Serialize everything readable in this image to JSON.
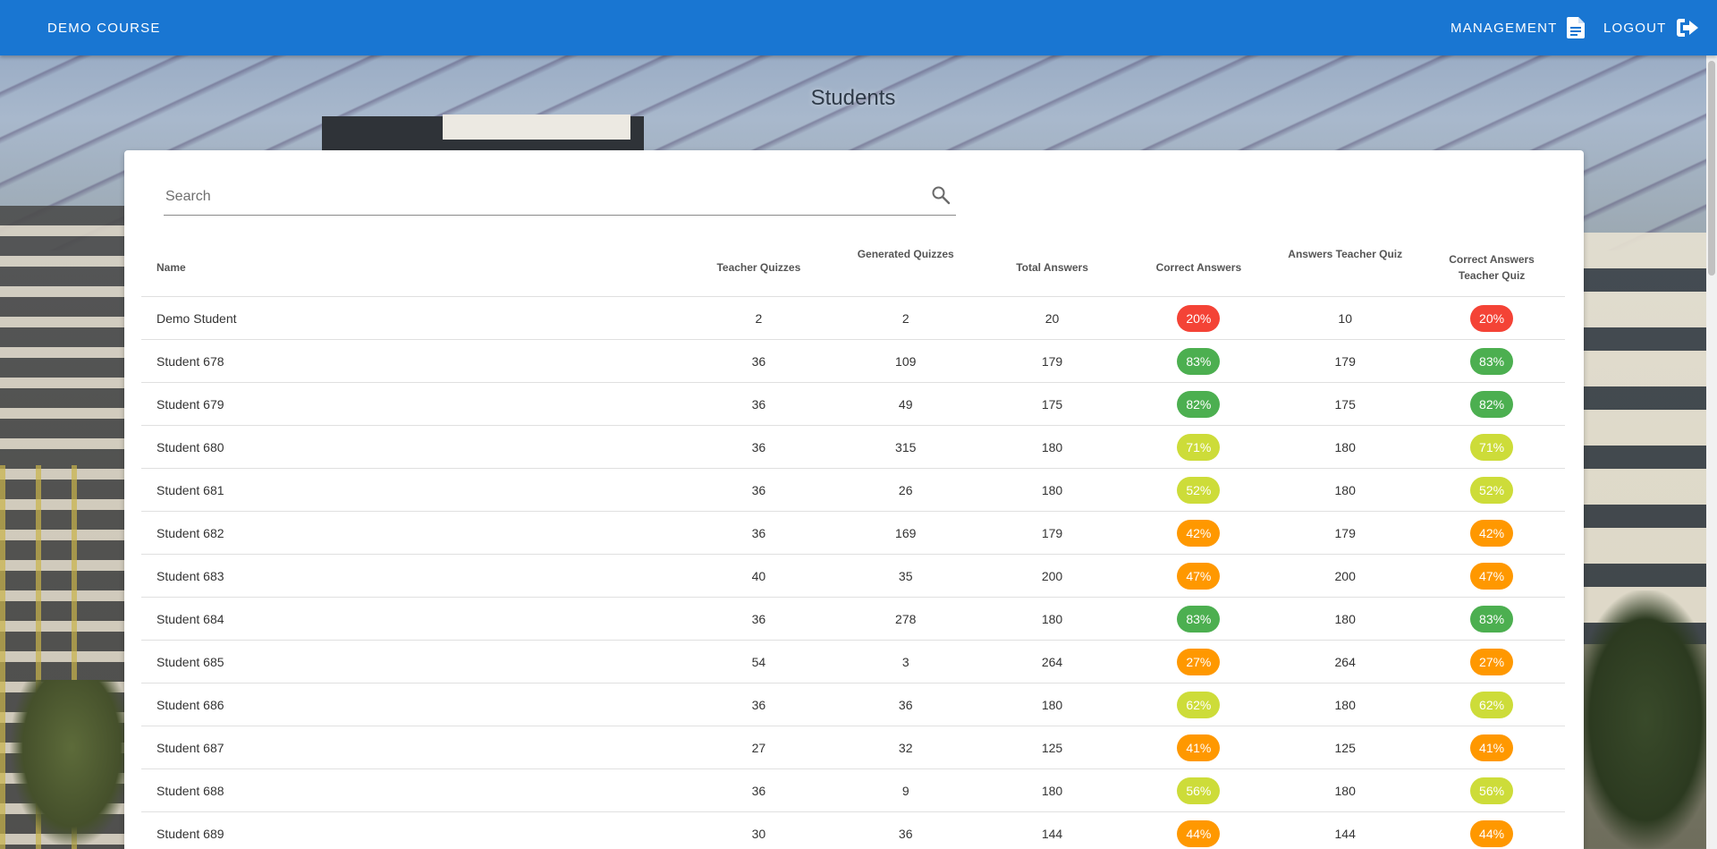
{
  "app_bar": {
    "brand": "DEMO COURSE",
    "management_label": "MANAGEMENT",
    "management_icon": "document-icon",
    "logout_label": "LOGOUT",
    "logout_icon": "logout-icon",
    "color": "#1976d2"
  },
  "page_title": "Students",
  "search": {
    "placeholder": "Search",
    "value": "",
    "icon": "search-icon"
  },
  "table": {
    "columns": {
      "name": "Name",
      "teacher_quizzes": "Teacher Quizzes",
      "generated_quizzes": "Generated Quizzes",
      "total_answers": "Total Answers",
      "correct_answers": "Correct Answers",
      "answers_teacher_quiz": "Answers Teacher Quiz",
      "correct_answers_teacher_quiz_line1": "Correct Answers",
      "correct_answers_teacher_quiz_line2": "Teacher Quiz"
    },
    "rows": [
      {
        "name": "Demo Student",
        "teacher_quizzes": "2",
        "generated_quizzes": "2",
        "total_answers": "20",
        "correct_answers": "20%",
        "answers_teacher_quiz": "10",
        "correct_answers_teacher_quiz": "20%",
        "chip_color": "#f44336"
      },
      {
        "name": "Student 678",
        "teacher_quizzes": "36",
        "generated_quizzes": "109",
        "total_answers": "179",
        "correct_answers": "83%",
        "answers_teacher_quiz": "179",
        "correct_answers_teacher_quiz": "83%",
        "chip_color": "#4caf50"
      },
      {
        "name": "Student 679",
        "teacher_quizzes": "36",
        "generated_quizzes": "49",
        "total_answers": "175",
        "correct_answers": "82%",
        "answers_teacher_quiz": "175",
        "correct_answers_teacher_quiz": "82%",
        "chip_color": "#4caf50"
      },
      {
        "name": "Student 680",
        "teacher_quizzes": "36",
        "generated_quizzes": "315",
        "total_answers": "180",
        "correct_answers": "71%",
        "answers_teacher_quiz": "180",
        "correct_answers_teacher_quiz": "71%",
        "chip_color": "#cddc39"
      },
      {
        "name": "Student 681",
        "teacher_quizzes": "36",
        "generated_quizzes": "26",
        "total_answers": "180",
        "correct_answers": "52%",
        "answers_teacher_quiz": "180",
        "correct_answers_teacher_quiz": "52%",
        "chip_color": "#cddc39"
      },
      {
        "name": "Student 682",
        "teacher_quizzes": "36",
        "generated_quizzes": "169",
        "total_answers": "179",
        "correct_answers": "42%",
        "answers_teacher_quiz": "179",
        "correct_answers_teacher_quiz": "42%",
        "chip_color": "#ff9800"
      },
      {
        "name": "Student 683",
        "teacher_quizzes": "40",
        "generated_quizzes": "35",
        "total_answers": "200",
        "correct_answers": "47%",
        "answers_teacher_quiz": "200",
        "correct_answers_teacher_quiz": "47%",
        "chip_color": "#ff9800"
      },
      {
        "name": "Student 684",
        "teacher_quizzes": "36",
        "generated_quizzes": "278",
        "total_answers": "180",
        "correct_answers": "83%",
        "answers_teacher_quiz": "180",
        "correct_answers_teacher_quiz": "83%",
        "chip_color": "#4caf50"
      },
      {
        "name": "Student 685",
        "teacher_quizzes": "54",
        "generated_quizzes": "3",
        "total_answers": "264",
        "correct_answers": "27%",
        "answers_teacher_quiz": "264",
        "correct_answers_teacher_quiz": "27%",
        "chip_color": "#ff9800"
      },
      {
        "name": "Student 686",
        "teacher_quizzes": "36",
        "generated_quizzes": "36",
        "total_answers": "180",
        "correct_answers": "62%",
        "answers_teacher_quiz": "180",
        "correct_answers_teacher_quiz": "62%",
        "chip_color": "#cddc39"
      },
      {
        "name": "Student 687",
        "teacher_quizzes": "27",
        "generated_quizzes": "32",
        "total_answers": "125",
        "correct_answers": "41%",
        "answers_teacher_quiz": "125",
        "correct_answers_teacher_quiz": "41%",
        "chip_color": "#ff9800"
      },
      {
        "name": "Student 688",
        "teacher_quizzes": "36",
        "generated_quizzes": "9",
        "total_answers": "180",
        "correct_answers": "56%",
        "answers_teacher_quiz": "180",
        "correct_answers_teacher_quiz": "56%",
        "chip_color": "#cddc39"
      },
      {
        "name": "Student 689",
        "teacher_quizzes": "30",
        "generated_quizzes": "36",
        "total_answers": "144",
        "correct_answers": "44%",
        "answers_teacher_quiz": "144",
        "correct_answers_teacher_quiz": "44%",
        "chip_color": "#ff9800"
      }
    ]
  }
}
